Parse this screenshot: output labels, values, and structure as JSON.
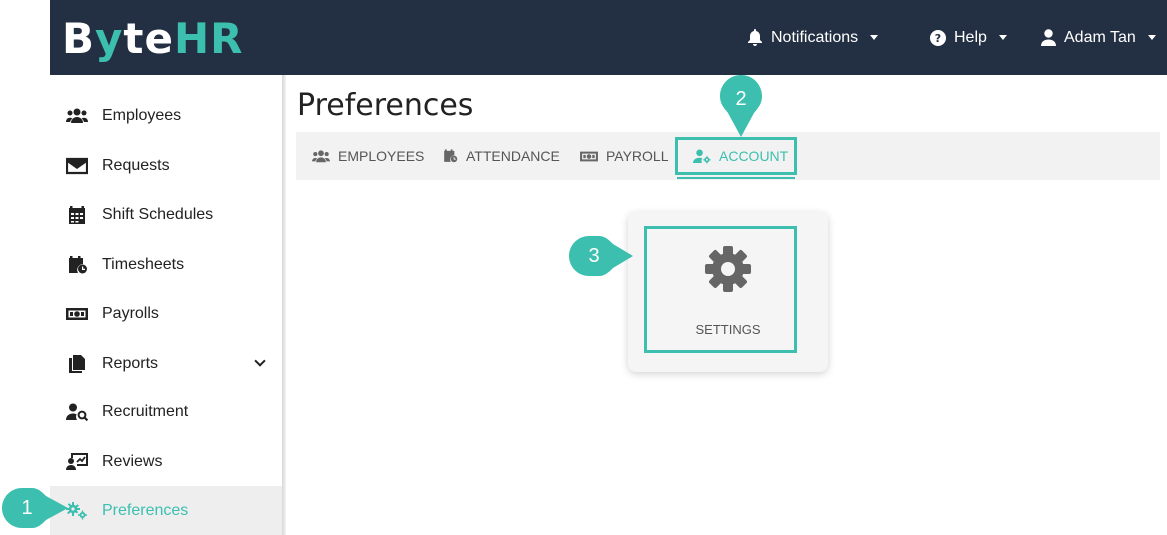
{
  "header": {
    "logo": {
      "b": "B",
      "y": "y",
      "te": "te",
      "hr": "HR"
    },
    "notifications_label": "Notifications",
    "help_label": "Help",
    "user_name": "Adam Tan"
  },
  "sidebar": {
    "items": [
      {
        "label": "Employees",
        "icon": "users-icon"
      },
      {
        "label": "Requests",
        "icon": "envelope-icon"
      },
      {
        "label": "Shift Schedules",
        "icon": "calendar-icon"
      },
      {
        "label": "Timesheets",
        "icon": "calendar-clock-icon"
      },
      {
        "label": "Payrolls",
        "icon": "money-icon"
      },
      {
        "label": "Reports",
        "icon": "document-icon"
      },
      {
        "label": "Recruitment",
        "icon": "user-search-icon"
      },
      {
        "label": "Reviews",
        "icon": "review-icon"
      },
      {
        "label": "Preferences",
        "icon": "gears-icon"
      }
    ]
  },
  "main": {
    "title": "Preferences",
    "tabs": [
      {
        "label": "EMPLOYEES"
      },
      {
        "label": "ATTENDANCE"
      },
      {
        "label": "PAYROLL"
      },
      {
        "label": "ACCOUNT"
      }
    ],
    "card": {
      "label": "SETTINGS",
      "icon": "gear-icon"
    }
  },
  "markers": [
    "1",
    "2",
    "3"
  ],
  "colors": {
    "accent": "#3cbfae",
    "topbar": "#232f43"
  }
}
